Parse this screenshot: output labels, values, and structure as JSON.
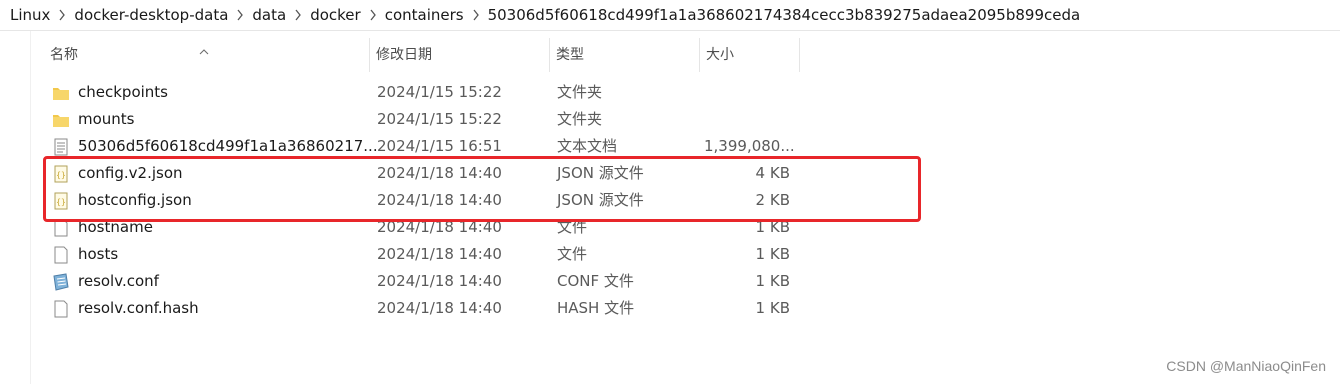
{
  "breadcrumb": [
    "Linux",
    "docker-desktop-data",
    "data",
    "docker",
    "containers",
    "50306d5f60618cd499f1a1a368602174384cecc3b839275adaea2095b899ceda"
  ],
  "columns": {
    "name": "名称",
    "date": "修改日期",
    "type": "类型",
    "size": "大小"
  },
  "files": [
    {
      "name": "checkpoints",
      "date": "2024/1/15 15:22",
      "type": "文件夹",
      "size": "",
      "icon": "folder-icon"
    },
    {
      "name": "mounts",
      "date": "2024/1/15 15:22",
      "type": "文件夹",
      "size": "",
      "icon": "folder-icon"
    },
    {
      "name": "50306d5f60618cd499f1a1a36860217...",
      "date": "2024/1/15 16:51",
      "type": "文本文档",
      "size": "1,399,080...",
      "icon": "text-document-icon"
    },
    {
      "name": "config.v2.json",
      "date": "2024/1/18 14:40",
      "type": "JSON 源文件",
      "size": "4 KB",
      "icon": "json-file-icon"
    },
    {
      "name": "hostconfig.json",
      "date": "2024/1/18 14:40",
      "type": "JSON 源文件",
      "size": "2 KB",
      "icon": "json-file-icon"
    },
    {
      "name": "hostname",
      "date": "2024/1/18 14:40",
      "type": "文件",
      "size": "1 KB",
      "icon": "file-icon"
    },
    {
      "name": "hosts",
      "date": "2024/1/18 14:40",
      "type": "文件",
      "size": "1 KB",
      "icon": "file-icon"
    },
    {
      "name": "resolv.conf",
      "date": "2024/1/18 14:40",
      "type": "CONF 文件",
      "size": "1 KB",
      "icon": "conf-file-icon"
    },
    {
      "name": "resolv.conf.hash",
      "date": "2024/1/18 14:40",
      "type": "HASH 文件",
      "size": "1 KB",
      "icon": "file-icon"
    }
  ],
  "watermark": "CSDN @ManNiaoQinFen",
  "colors": {
    "highlight": "#e8262a",
    "folder": "#f2c84b"
  }
}
